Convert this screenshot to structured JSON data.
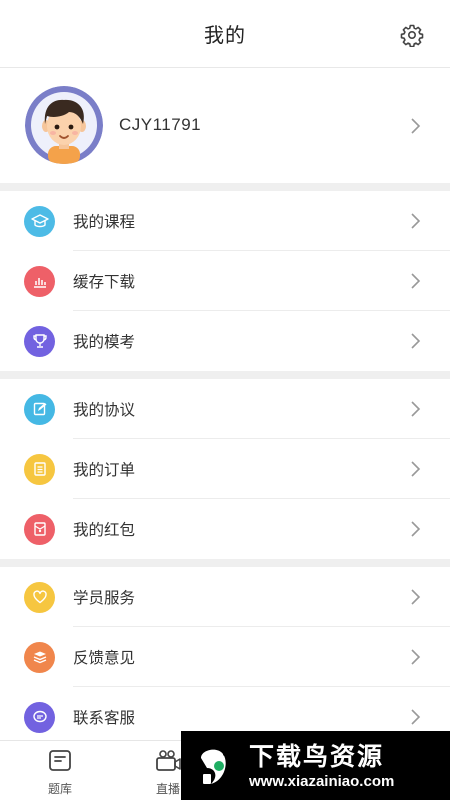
{
  "header": {
    "title": "我的"
  },
  "profile": {
    "username": "CJY11791"
  },
  "groups": [
    [
      {
        "label": "我的课程",
        "icon": "mortarboard-icon",
        "color": "#4dbbe6"
      },
      {
        "label": "缓存下载",
        "icon": "bar-chart-icon",
        "color": "#ee6068"
      },
      {
        "label": "我的模考",
        "icon": "trophy-icon",
        "color": "#7262e0"
      }
    ],
    [
      {
        "label": "我的协议",
        "icon": "edit-document-icon",
        "color": "#45b8e4"
      },
      {
        "label": "我的订单",
        "icon": "list-document-icon",
        "color": "#f6c640"
      },
      {
        "label": "我的红包",
        "icon": "red-envelope-icon",
        "color": "#ee6068"
      }
    ],
    [
      {
        "label": "学员服务",
        "icon": "heart-icon",
        "color": "#f6c640"
      },
      {
        "label": "反馈意见",
        "icon": "stacked-books-icon",
        "color": "#f0864c"
      },
      {
        "label": "联系客服",
        "icon": "chat-bubble-icon",
        "color": "#7262e0"
      }
    ]
  ],
  "tabbar": [
    {
      "label": "题库",
      "icon": "question-bank-icon"
    },
    {
      "label": "直播",
      "icon": "live-camera-icon"
    }
  ],
  "watermark": {
    "title": "下载鸟资源",
    "url": "www.xiazainiao.com"
  }
}
